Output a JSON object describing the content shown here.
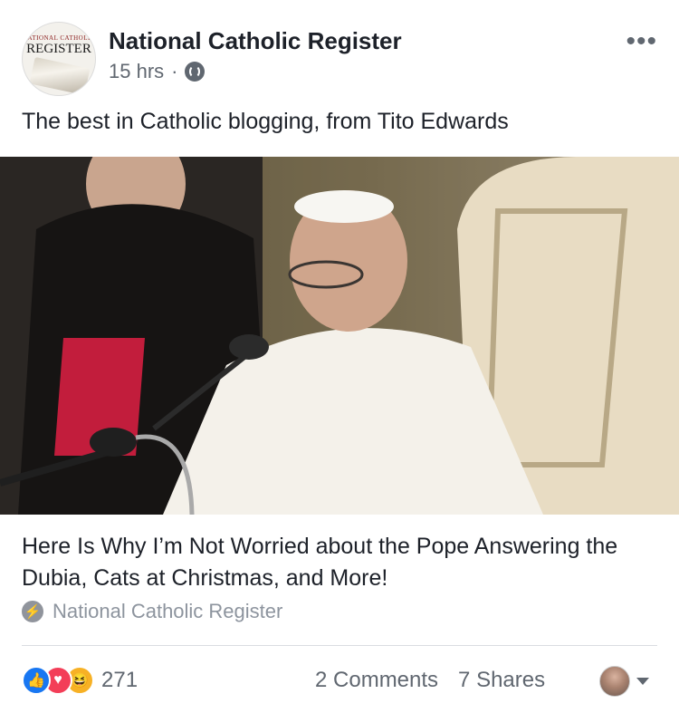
{
  "post": {
    "page_name": "National Catholic Register",
    "avatar_text_top": "NATIONAL CATHOLIC",
    "avatar_text_main": "REGISTER",
    "timestamp": "15 hrs",
    "separator": "·",
    "audience_icon": "globe-icon",
    "more_icon": "•••",
    "caption": "The best in Catholic blogging, from Tito Edwards"
  },
  "link": {
    "title": "Here Is Why I’m Not Worried about the Pope Answering the Dubia, Cats at Christmas, and More!",
    "source_icon": "lightning-icon",
    "source": "National Catholic Register"
  },
  "footer": {
    "reaction_icons": [
      "like-icon",
      "love-icon",
      "haha-icon"
    ],
    "reaction_count": "271",
    "comments": "2 Comments",
    "shares": "7 Shares"
  },
  "colors": {
    "text_primary": "#1d2129",
    "text_secondary": "#606770",
    "like": "#1877f2",
    "love": "#f33e58",
    "haha": "#f7b125"
  }
}
